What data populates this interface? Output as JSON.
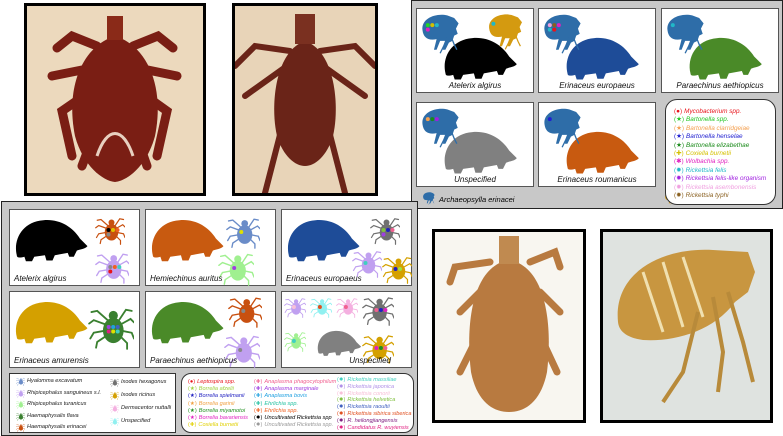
{
  "colors": {
    "tick_photo1": "#7a1e14",
    "tick_photo2": "#6a2418",
    "tick_photo3": "#b87a40",
    "flea_photo": "#b8862e"
  },
  "photos": [
    {
      "name": "tick-photo-dorsal-male",
      "subject": "tick",
      "bg": "#ecd9bd"
    },
    {
      "name": "tick-photo-dorsal-female",
      "subject": "tick",
      "bg": "#e8d4b8"
    },
    {
      "name": "tick-photo-slide",
      "subject": "tick",
      "bg": "#f8f6f0"
    },
    {
      "name": "flea-photo-slide",
      "subject": "flea",
      "bg": "#dfe3e0"
    }
  ],
  "flea_panel": {
    "tiles": [
      {
        "host": "Atelerix algirus",
        "host_color": "#000000",
        "fleas": [
          {
            "species": "Archaeopsylla erinacei",
            "color": "#2e6da8",
            "marks": [
              "#22d522",
              "#d4c000",
              "#20b8c8",
              "#e020c0"
            ]
          },
          {
            "species": "Ctenocephalides felis",
            "color": "#d49a10",
            "marks": [
              "#20b8c8"
            ]
          }
        ]
      },
      {
        "host": "Erinaceus europaeus",
        "host_color": "#1e4c98",
        "fleas": [
          {
            "species": "Archaeopsylla erinacei",
            "color": "#2e6da8",
            "marks": [
              "#f0a0e0",
              "#8a6020",
              "#e020c0",
              "#20b8c8",
              "#e8141b"
            ]
          }
        ]
      },
      {
        "host": "Paraechinus aethiopicus",
        "host_color": "#4a8a28",
        "fleas": [
          {
            "species": "Archaeopsylla erinacei",
            "color": "#2e6da8",
            "marks": [
              "#20b8c8"
            ]
          }
        ]
      },
      {
        "host": "Unspecified",
        "host_color": "#808080",
        "fleas": [
          {
            "species": "Archaeopsylla erinacei",
            "color": "#2e6da8",
            "marks": [
              "#f4a050",
              "#1a8a1a",
              "#a020e0"
            ]
          }
        ]
      },
      {
        "host": "Erinaceus roumanicus",
        "host_color": "#c85a10",
        "fleas": [
          {
            "species": "Archaeopsylla erinacei",
            "color": "#2e6da8",
            "marks": [
              "#2020d0"
            ]
          }
        ]
      }
    ],
    "flea_legend": [
      {
        "label": "Archaeopsylla erinacei",
        "color": "#2e6da8"
      },
      {
        "label": "Ctenocephalides felis",
        "color": "#d49a10"
      }
    ],
    "pathogen_legend": [
      {
        "symbol": "(●)",
        "label": "Mycobacterium spp.",
        "color": "#e8141b"
      },
      {
        "symbol": "(★)",
        "label": "Bartonella spp.",
        "color": "#22c522"
      },
      {
        "symbol": "(★)",
        "label": "Bartonella clarridgeiae",
        "color": "#f4a050"
      },
      {
        "symbol": "(★)",
        "label": "Bartonella henselae",
        "color": "#2020d0"
      },
      {
        "symbol": "(★)",
        "label": "Bartonella elizabethae",
        "color": "#1a8a1a"
      },
      {
        "symbol": "(✚)",
        "label": "Coxiella burnetii",
        "color": "#d4c000"
      },
      {
        "symbol": "(✱)",
        "label": "Wolbachia spp.",
        "color": "#e020c0"
      },
      {
        "symbol": "(✹)",
        "label": "Rickettsia felis",
        "color": "#20b8c8"
      },
      {
        "symbol": "(✹)",
        "label": "Rickettsia felis-like organism",
        "color": "#a020e0"
      },
      {
        "symbol": "(✹)",
        "label": "Rickettsia asembonensis",
        "color": "#f0a0e0"
      },
      {
        "symbol": "(✹)",
        "label": "Rickettsia typhi",
        "color": "#8a6020"
      }
    ]
  },
  "tick_panel": {
    "tiles": [
      {
        "host": "Atelerix algirus",
        "host_color": "#000000",
        "ticks": [
          {
            "color": "#c85010",
            "marks": [
              "#000000",
              "#e0c000",
              "#f06020",
              "#888888"
            ]
          },
          {
            "color": "#c0a0f0",
            "marks": [
              "#888888",
              "#f06020",
              "#40d0c0",
              "#e8141b"
            ]
          }
        ]
      },
      {
        "host": "Hemiechinus auritus",
        "host_color": "#c85a10",
        "ticks": [
          {
            "color": "#6a8cc8",
            "marks": [
              "#e0e000"
            ]
          },
          {
            "color": "#a0f090",
            "marks": [
              "#a040e0"
            ]
          }
        ]
      },
      {
        "host": "Erinaceus europaeus",
        "host_color": "#1e4c98",
        "ticks": [
          {
            "color": "#707070",
            "marks": [
              "#80c040",
              "#2020c0",
              "#f06090",
              "#a040e0"
            ]
          },
          {
            "color": "#c0a0f0",
            "marks": [
              "#40d0c0"
            ]
          },
          {
            "color": "#d4a000",
            "marks": [
              "#2020c0",
              "#a0e040"
            ]
          }
        ]
      },
      {
        "host": "Erinaceus amurensis",
        "host_color": "#d4a000",
        "ticks": [
          {
            "color": "#3a8030",
            "marks": [
              "#a040e0",
              "#20a0e0",
              "#4060c0",
              "#e02080",
              "#e0e000",
              "#40d0c0"
            ]
          }
        ]
      },
      {
        "host": "Paraechinus aethiopicus",
        "host_color": "#4a8a28",
        "ticks": [
          {
            "color": "#c85010",
            "marks": [
              "#888888"
            ]
          },
          {
            "color": "#c0a0f0",
            "marks": [
              "#888888"
            ]
          }
        ]
      },
      {
        "host": "Unspecified",
        "host_color": "#808080",
        "ticks": [
          {
            "color": "#c0a0f0",
            "marks": [
              "#f8c0d8"
            ]
          },
          {
            "color": "#90f0f0",
            "marks": [
              "#e05020"
            ]
          },
          {
            "color": "#f4b0e0",
            "marks": [
              "#f06090"
            ]
          },
          {
            "color": "#707070",
            "marks": [
              "#f06090",
              "#2020c0",
              "#e020c0"
            ]
          },
          {
            "color": "#a0f090",
            "marks": [
              "#40d0c0"
            ]
          },
          {
            "color": "#d4a000",
            "marks": [
              "#e020c0",
              "#209020",
              "#f06090"
            ]
          }
        ]
      }
    ],
    "tick_legend": [
      {
        "label": "Hyalomma excavatum",
        "color": "#6a8cc8"
      },
      {
        "label": "Rhipicephalus sanguineus s.l.",
        "color": "#c0a0f0"
      },
      {
        "label": "Rhipicephalus turanicus",
        "color": "#a0f090"
      },
      {
        "label": "Haemaphysalis flava",
        "color": "#3a8030"
      },
      {
        "label": "Haemaphysalis erinacei",
        "color": "#c85010"
      },
      {
        "label": "Ixodes hexagonus",
        "color": "#707070"
      },
      {
        "label": "Ixodes ricinus",
        "color": "#d4a000"
      },
      {
        "label": "Dermacentor nuttalli",
        "color": "#f4b0e0"
      },
      {
        "label": "Unspecified",
        "color": "#90f0f0"
      }
    ],
    "pathogen_legend": [
      [
        {
          "symbol": "(●)",
          "label": "Leptospira spp.",
          "color": "#e8141b"
        },
        {
          "symbol": "(★)",
          "label": "Borrelia afzelii",
          "color": "#a0d040"
        },
        {
          "symbol": "(★)",
          "label": "Borrelia spielmanii",
          "color": "#2020c0"
        },
        {
          "symbol": "(★)",
          "label": "Borrelia garinii",
          "color": "#f0a040"
        },
        {
          "symbol": "(★)",
          "label": "Borrelia miyamotoi",
          "color": "#209020"
        },
        {
          "symbol": "(★)",
          "label": "Borrelia bavariensis",
          "color": "#e020c0"
        },
        {
          "symbol": "(✚)",
          "label": "Coxiella burnetii",
          "color": "#e0d000"
        }
      ],
      [
        {
          "symbol": "(✚)",
          "label": "Anaplasma phagocytophilum",
          "color": "#f06090"
        },
        {
          "symbol": "(✚)",
          "label": "Anaplasma marginale",
          "color": "#a040e0"
        },
        {
          "symbol": "(✚)",
          "label": "Anaplasma bovis",
          "color": "#20a0e0"
        },
        {
          "symbol": "(✚)",
          "label": "Ehrlichia spp.",
          "color": "#20c0a0"
        },
        {
          "symbol": "(✚)",
          "label": "Ehrlichia spp.",
          "color": "#f06020"
        },
        {
          "symbol": "(✹)",
          "label": "Uncultivated Rickettsia spp",
          "color": "#000000"
        },
        {
          "symbol": "(✹)",
          "label": "Uncultivated Rickettsia spp.",
          "color": "#999999"
        }
      ],
      [
        {
          "symbol": "(✹)",
          "label": "Rickettsia massiliae",
          "color": "#40d0c0"
        },
        {
          "symbol": "(✹)",
          "label": "Rickettsia japonica",
          "color": "#b090e8"
        },
        {
          "symbol": "(✹)",
          "label": "Rickettsia conorii",
          "color": "#f8c0d8"
        },
        {
          "symbol": "(✹)",
          "label": "Rickettsia helvetica",
          "color": "#80c040"
        },
        {
          "symbol": "(✹)",
          "label": "Rickettsia raoultii",
          "color": "#4060c0"
        },
        {
          "symbol": "(✹)",
          "label": "Rickettsia sibirica siberica",
          "color": "#e05020"
        },
        {
          "symbol": "(✹)",
          "label": "R. heilongjiangensis",
          "color": "#802080"
        },
        {
          "symbol": "(✹)",
          "label": "Candidatus R. wuyiensis",
          "color": "#e02080"
        }
      ]
    ]
  }
}
